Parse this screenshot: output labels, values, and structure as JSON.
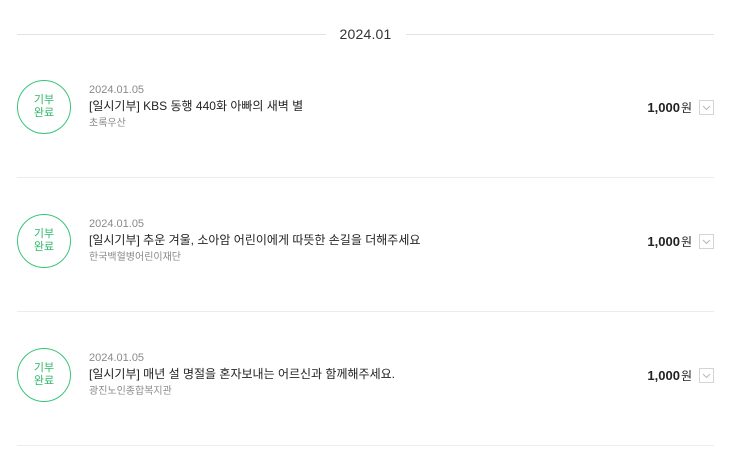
{
  "month_label": "2024.01",
  "colors": {
    "badge_green": "#2fb86a",
    "divider": "#e2e2e2"
  },
  "donations": [
    {
      "status_line1": "기부",
      "status_line2": "완료",
      "date": "2024.01.05",
      "title": "[일시기부] KBS 동행 440화 아빠의 새벽 별",
      "org": "초록우산",
      "amount": "1,000",
      "unit": "원",
      "toggle_icon": "chevron-down-icon"
    },
    {
      "status_line1": "기부",
      "status_line2": "완료",
      "date": "2024.01.05",
      "title": "[일시기부] 추운 겨울, 소아암 어린이에게 따뜻한 손길을 더해주세요",
      "org": "한국백혈병어린이재단",
      "amount": "1,000",
      "unit": "원",
      "toggle_icon": "chevron-down-icon"
    },
    {
      "status_line1": "기부",
      "status_line2": "완료",
      "date": "2024.01.05",
      "title": "[일시기부] 매년 설 명절을 혼자보내는 어르신과 함께해주세요.",
      "org": "광진노인종합복지관",
      "amount": "1,000",
      "unit": "원",
      "toggle_icon": "chevron-down-icon"
    }
  ]
}
